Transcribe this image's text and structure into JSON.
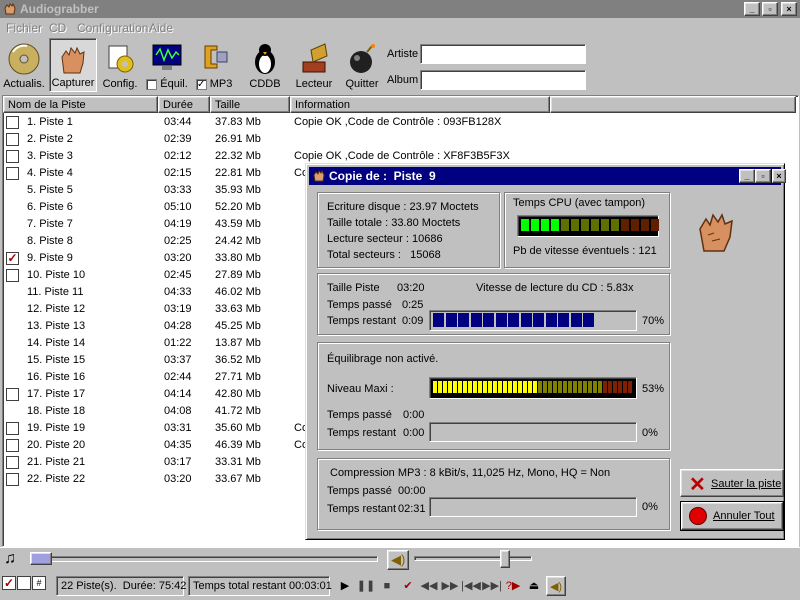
{
  "app": {
    "title": "Audiograbber"
  },
  "menu": [
    "Fichier",
    "CD",
    "Configuration",
    "Aide"
  ],
  "toolbar": {
    "refresh": "Actualis.",
    "capture": "Capturer",
    "config": "Config.",
    "equil": "Équil.",
    "mp3": "MP3",
    "cddb": "CDDB",
    "player": "Lecteur",
    "quit": "Quitter",
    "artist_label": "Artiste",
    "album_label": "Album",
    "artist_value": "",
    "album_value": ""
  },
  "columns": [
    "Nom de la Piste",
    "Durée",
    "Taille",
    "Information"
  ],
  "tracks": [
    {
      "name": "1. Piste  1",
      "dur": "03:44",
      "size": "37.83 Mb",
      "info": "Copie OK ,Code de Contrôle : 093FB128X",
      "checkbox": true,
      "checked": false
    },
    {
      "name": "2. Piste  2",
      "dur": "02:39",
      "size": "26.91 Mb",
      "info": "",
      "checkbox": true,
      "checked": false
    },
    {
      "name": "3. Piste  3",
      "dur": "02:12",
      "size": "22.32 Mb",
      "info": "Copie OK ,Code de Contrôle : XF8F3B5F3X",
      "checkbox": true,
      "checked": false
    },
    {
      "name": "4. Piste  4",
      "dur": "02:15",
      "size": "22.81 Mb",
      "info": "Co",
      "checkbox": true,
      "checked": false
    },
    {
      "name": "5. Piste  5",
      "dur": "03:33",
      "size": "35.93 Mb",
      "info": "",
      "checkbox": false,
      "checked": false
    },
    {
      "name": "6. Piste  6",
      "dur": "05:10",
      "size": "52.20 Mb",
      "info": "",
      "checkbox": false,
      "checked": false
    },
    {
      "name": "7. Piste  7",
      "dur": "04:19",
      "size": "43.59 Mb",
      "info": "",
      "checkbox": false,
      "checked": false
    },
    {
      "name": "8. Piste  8",
      "dur": "02:25",
      "size": "24.42 Mb",
      "info": "",
      "checkbox": false,
      "checked": false
    },
    {
      "name": "9. Piste  9",
      "dur": "03:20",
      "size": "33.80 Mb",
      "info": "",
      "checkbox": true,
      "checked": true
    },
    {
      "name": "10. Piste 10",
      "dur": "02:45",
      "size": "27.89 Mb",
      "info": "",
      "checkbox": true,
      "checked": false
    },
    {
      "name": "11. Piste 11",
      "dur": "04:33",
      "size": "46.02 Mb",
      "info": "",
      "checkbox": false,
      "checked": false
    },
    {
      "name": "12. Piste 12",
      "dur": "03:19",
      "size": "33.63 Mb",
      "info": "",
      "checkbox": false,
      "checked": false
    },
    {
      "name": "13. Piste 13",
      "dur": "04:28",
      "size": "45.25 Mb",
      "info": "",
      "checkbox": false,
      "checked": false
    },
    {
      "name": "14. Piste 14",
      "dur": "01:22",
      "size": "13.87 Mb",
      "info": "",
      "checkbox": false,
      "checked": false
    },
    {
      "name": "15. Piste 15",
      "dur": "03:37",
      "size": "36.52 Mb",
      "info": "",
      "checkbox": false,
      "checked": false
    },
    {
      "name": "16. Piste 16",
      "dur": "02:44",
      "size": "27.71 Mb",
      "info": "",
      "checkbox": false,
      "checked": false
    },
    {
      "name": "17. Piste 17",
      "dur": "04:14",
      "size": "42.80 Mb",
      "info": "",
      "checkbox": true,
      "checked": false
    },
    {
      "name": "18. Piste 18",
      "dur": "04:08",
      "size": "41.72 Mb",
      "info": "",
      "checkbox": false,
      "checked": false
    },
    {
      "name": "19. Piste 19",
      "dur": "03:31",
      "size": "35.60 Mb",
      "info": "Co",
      "checkbox": true,
      "checked": false
    },
    {
      "name": "20. Piste 20",
      "dur": "04:35",
      "size": "46.39 Mb",
      "info": "Co",
      "checkbox": true,
      "checked": false
    },
    {
      "name": "21. Piste 21",
      "dur": "03:17",
      "size": "33.31 Mb",
      "info": "",
      "checkbox": true,
      "checked": false
    },
    {
      "name": "22. Piste 22",
      "dur": "03:20",
      "size": "33.67 Mb",
      "info": "",
      "checkbox": true,
      "checked": false
    }
  ],
  "dialog": {
    "title": "Copie de :  Piste  9",
    "disk_write": "Ecriture disque : 23.97 Moctets",
    "total_size": "Taille totale :  33.80 Moctets",
    "sector_read": "Lecture secteur : 10686",
    "total_sectors": "Total secteurs :   15068",
    "cpu_label": "Temps CPU (avec tampon)",
    "cpu_level": 0.29,
    "speed_issues": "Pb de vitesse éventuels : 121",
    "track_size_label": "Taille Piste",
    "track_size_value": "03:20",
    "read_speed": "Vitesse de lecture du CD : 5.83x",
    "elapsed_label": "Temps passé",
    "elapsed_value": "0:25",
    "remaining_label": "Temps restant",
    "remaining_value": "0:09",
    "progress_pct": "70%",
    "progress_fraction": 0.7,
    "norm_status": "Équilibrage non activé.",
    "max_level_label": "Niveau Maxi :",
    "max_level_pct": "53%",
    "max_level_fraction": 0.53,
    "norm_elapsed_label": "Temps passé",
    "norm_elapsed_value": "0:00",
    "norm_remaining_label": "Temps restant",
    "norm_remaining_value": "0:00",
    "norm_pct": "0%",
    "mp3_info": "Compression MP3 : 8 kBit/s, 11,025 Hz, Mono, HQ = Non",
    "mp3_elapsed_label": "Temps passé",
    "mp3_elapsed_value": "00:00",
    "mp3_remaining_label": "Temps restant",
    "mp3_remaining_value": "02:31",
    "mp3_pct": "0%",
    "skip_button": "Sauter la piste",
    "cancel_button": "Annuler Tout"
  },
  "player": {
    "position": 0.0,
    "volume": 0.8
  },
  "status": {
    "tracks": "22 Piste(s).",
    "duration": "Durée: 75:42",
    "remaining": "Temps total restant 00:03:01"
  }
}
